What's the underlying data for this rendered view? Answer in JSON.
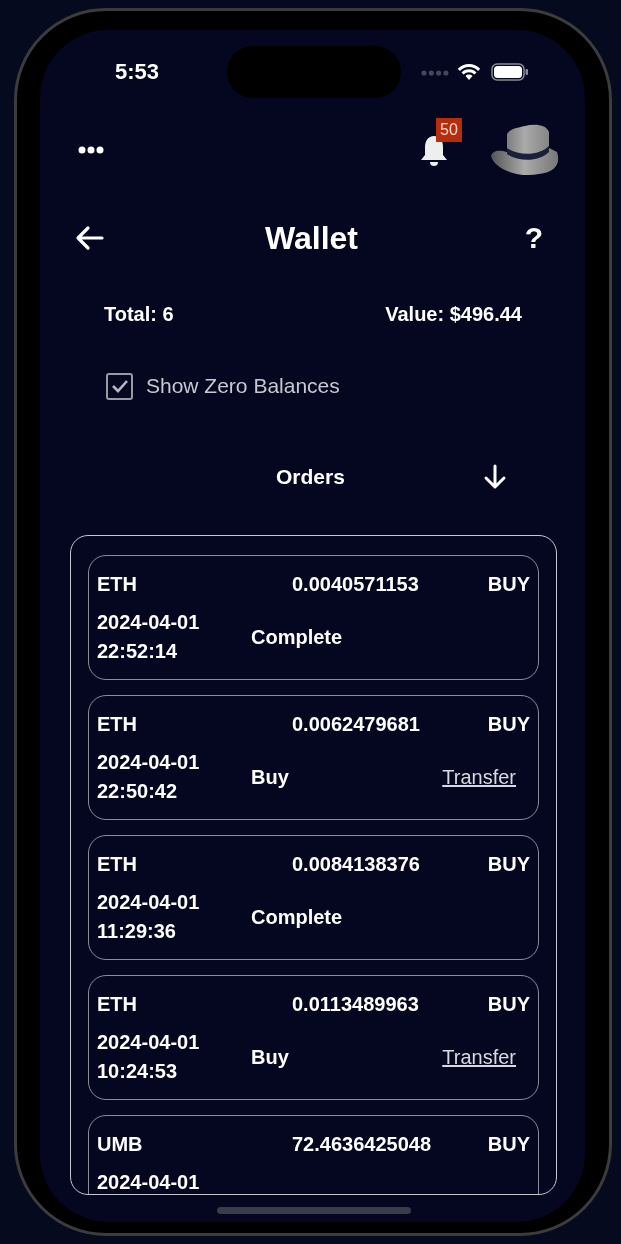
{
  "status_bar": {
    "time": "5:53"
  },
  "header": {
    "notification_count": "50"
  },
  "title": "Wallet",
  "help": {
    "label": "?"
  },
  "summary": {
    "total": "Total: 6",
    "value": "Value: $496.44"
  },
  "show_zero_balances": {
    "label": "Show Zero Balances",
    "checked": true
  },
  "orders": {
    "label": "Orders"
  },
  "order_cards": [
    {
      "symbol": "ETH",
      "amount": "0.0040571153",
      "side": "BUY",
      "date": "2024-04-01",
      "time": "22:52:14",
      "status": "Complete"
    },
    {
      "symbol": "ETH",
      "amount": "0.0062479681",
      "side": "BUY",
      "date": "2024-04-01",
      "time": "22:50:42",
      "status": "Buy",
      "action": "Transfer"
    },
    {
      "symbol": "ETH",
      "amount": "0.0084138376",
      "side": "BUY",
      "date": "2024-04-01",
      "time": "11:29:36",
      "status": "Complete"
    },
    {
      "symbol": "ETH",
      "amount": "0.0113489963",
      "side": "BUY",
      "date": "2024-04-01",
      "time": "10:24:53",
      "status": "Buy",
      "action": "Transfer"
    },
    {
      "symbol": "UMB",
      "amount": "72.4636425048",
      "side": "BUY",
      "date": "2024-04-01"
    }
  ]
}
